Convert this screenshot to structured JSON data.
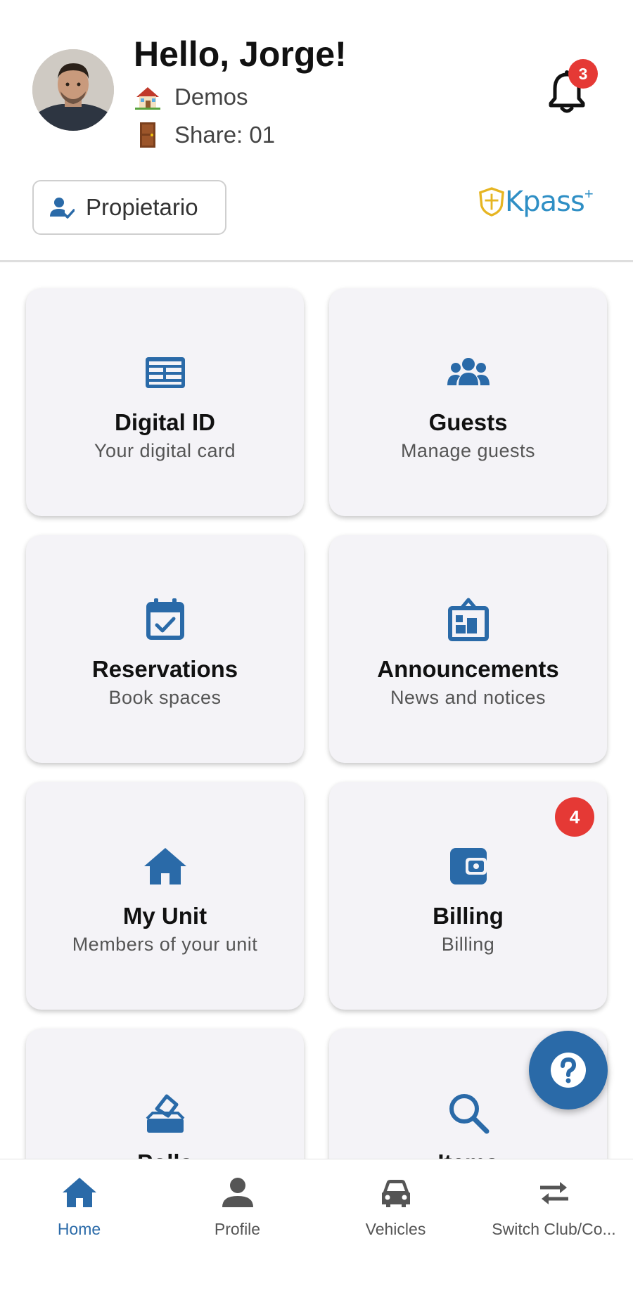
{
  "header": {
    "greeting": "Hello, Jorge!",
    "club_name": "Demos",
    "share_label": "Share: 01",
    "notification_count": "3",
    "role_label": "Propietario",
    "logo_text": "Kpass",
    "logo_sup": "+"
  },
  "colors": {
    "primary": "#2a6aa8",
    "badge": "#e53935",
    "card_bg": "#f4f3f7"
  },
  "cards": [
    {
      "title": "Digital ID",
      "subtitle": "Your digital card",
      "icon": "id-card-icon"
    },
    {
      "title": "Guests",
      "subtitle": "Manage guests",
      "icon": "groups-icon"
    },
    {
      "title": "Reservations",
      "subtitle": "Book spaces",
      "icon": "calendar-check-icon"
    },
    {
      "title": "Announcements",
      "subtitle": "News and notices",
      "icon": "notice-board-icon"
    },
    {
      "title": "My Unit",
      "subtitle": "Members of your unit",
      "icon": "home-icon"
    },
    {
      "title": "Billing",
      "subtitle": "Billing",
      "icon": "wallet-icon",
      "badge": "4"
    },
    {
      "title": "Polls",
      "subtitle": "",
      "icon": "ballot-box-icon"
    },
    {
      "title": "Items",
      "subtitle": "",
      "icon": "search-icon"
    }
  ],
  "fab": {
    "icon": "help-icon"
  },
  "bottom_nav": [
    {
      "label": "Home",
      "icon": "home-icon",
      "active": true
    },
    {
      "label": "Profile",
      "icon": "person-icon",
      "active": false
    },
    {
      "label": "Vehicles",
      "icon": "car-icon",
      "active": false
    },
    {
      "label": "Switch Club/Co...",
      "icon": "swap-icon",
      "active": false
    }
  ]
}
